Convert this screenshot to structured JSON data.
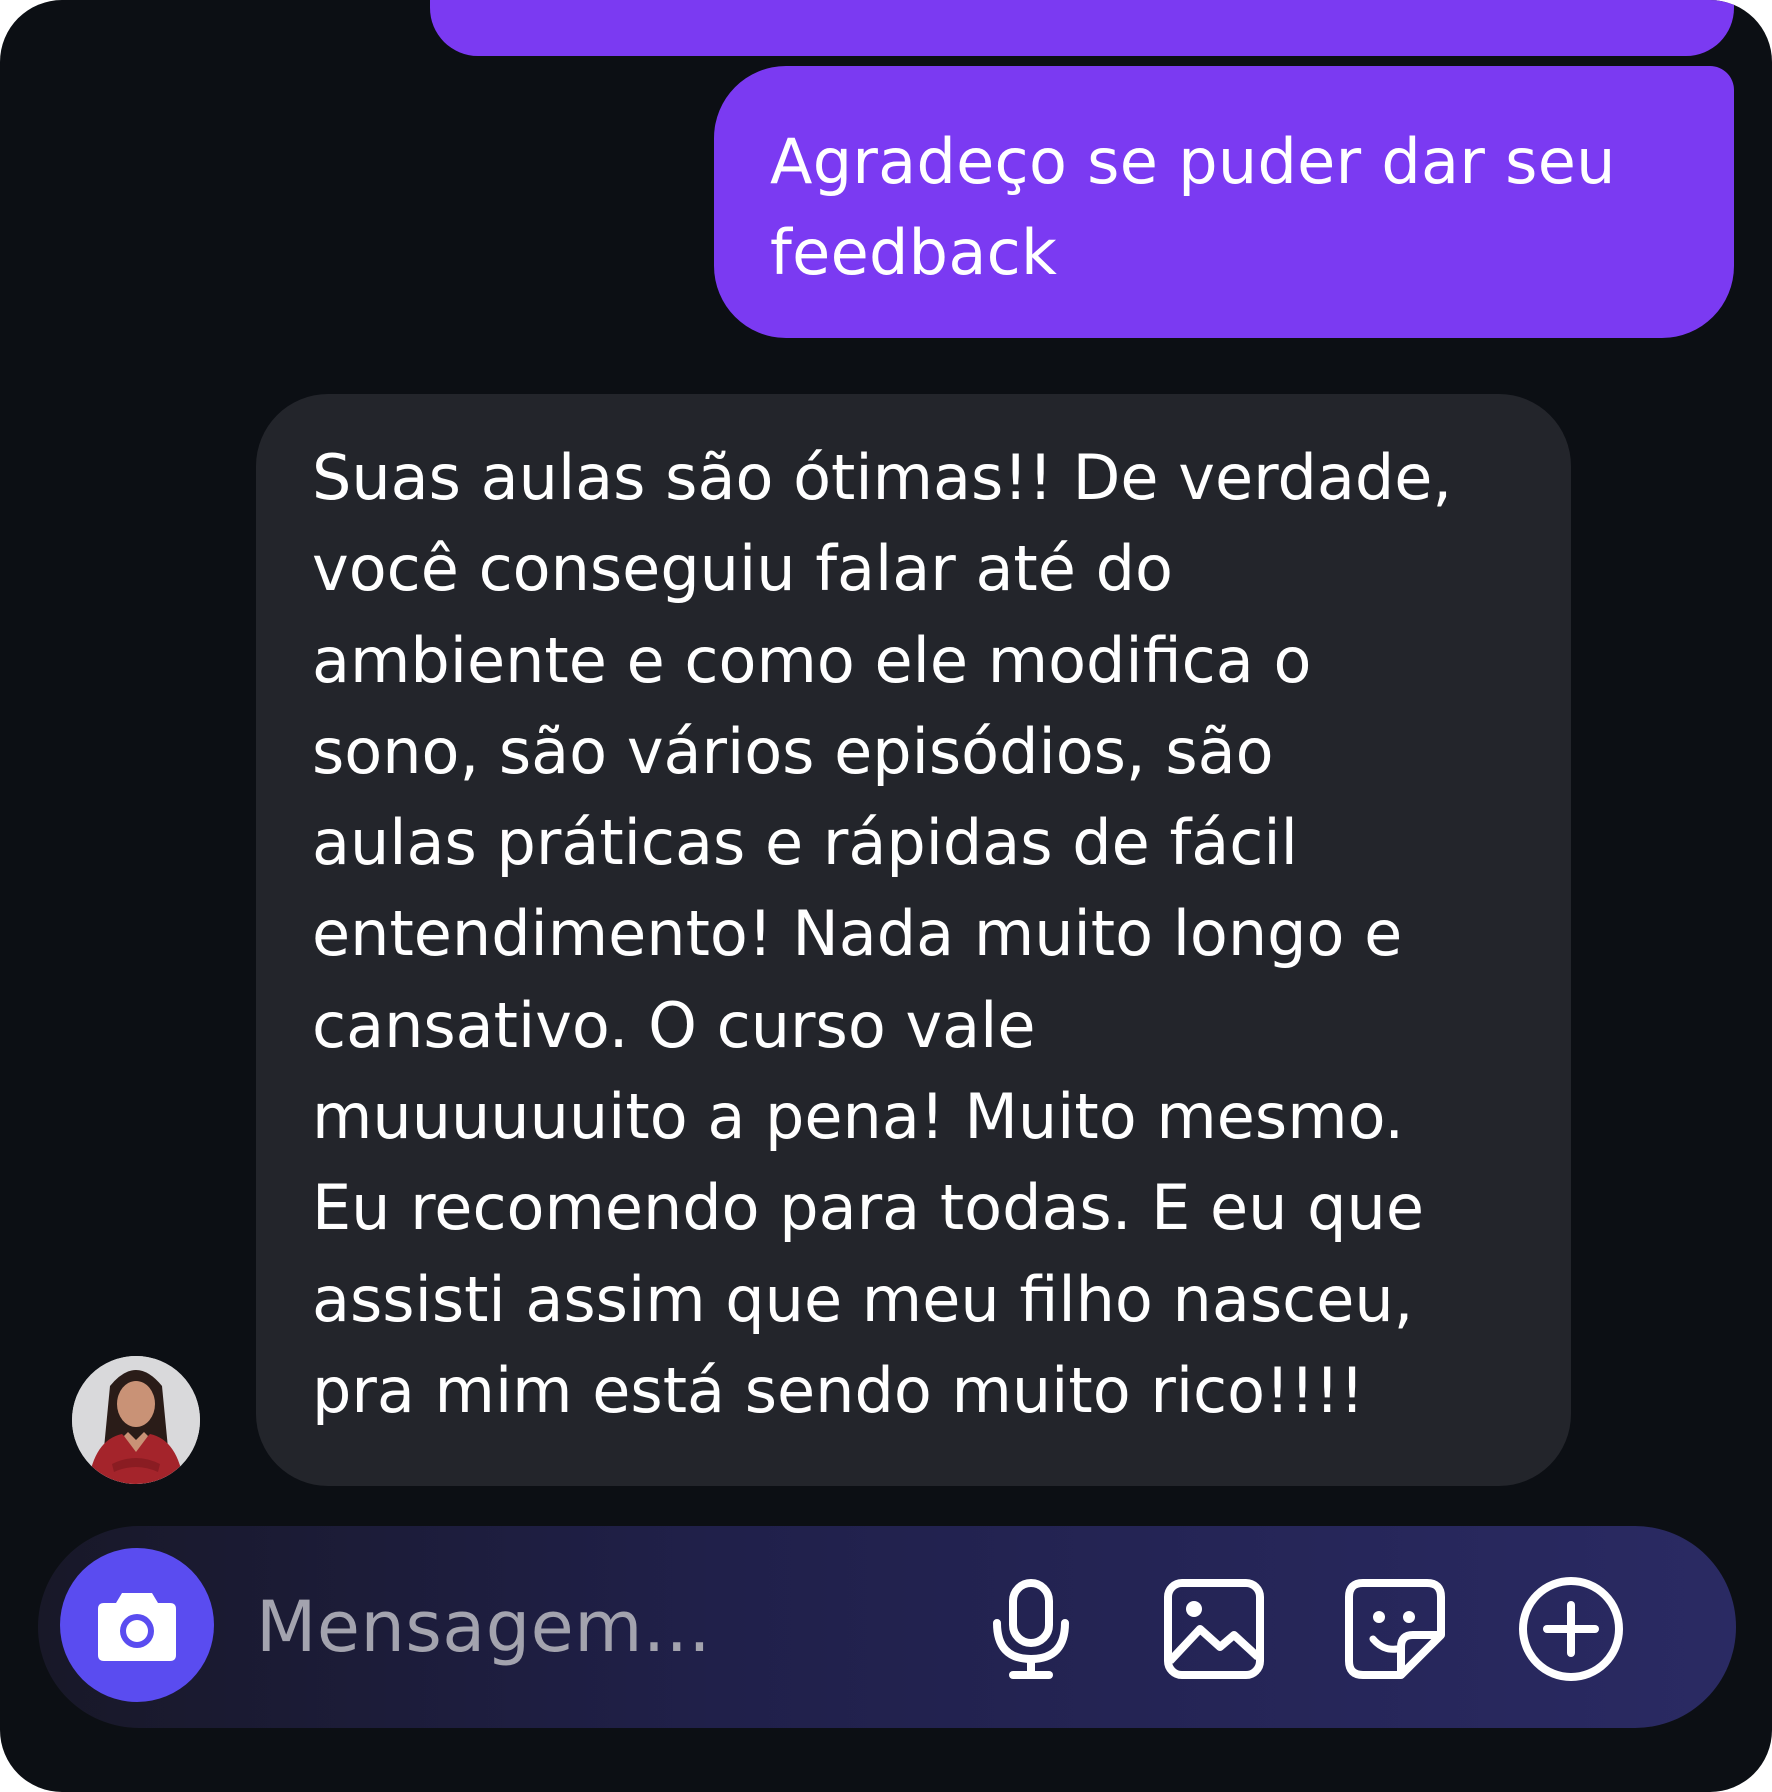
{
  "messages": [
    {
      "direction": "sent",
      "text": "Agradeço se puder dar seu\nfeedback"
    },
    {
      "direction": "received",
      "text": "Suas aulas são ótimas!! De verdade,\nvocê conseguiu falar até do\nambiente e como ele modifica o\nsono, são vários episódios, são\naulas práticas e rápidas de fácil\nentendimento! Nada muito longo e\ncansativo. O curso vale\nmuuuuuuito a pena! Muito mesmo.\nEu recomendo para todas. E eu que\nassisti assim que meu filho nasceu,\npra mim está sendo muito rico!!!!"
    }
  ],
  "composer": {
    "placeholder": "Mensagem...",
    "icons": [
      "camera-icon",
      "microphone-icon",
      "image-icon",
      "sticker-icon",
      "plus-circle-icon"
    ]
  },
  "colors": {
    "background": "#0c0f14",
    "sent_bubble": "#7b3af2",
    "received_bubble": "#23252b",
    "camera_button": "#5a4cf0"
  }
}
